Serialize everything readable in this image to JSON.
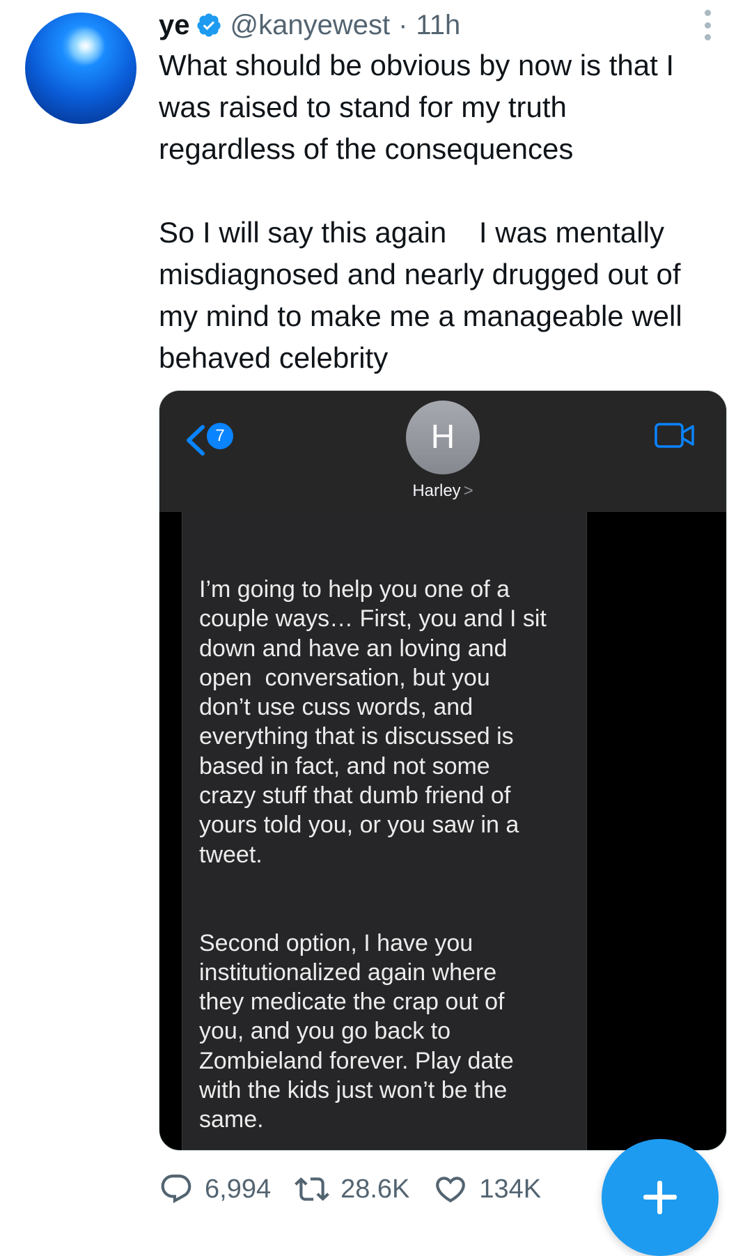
{
  "tweet": {
    "author": {
      "name": "ye",
      "handle": "@kanyewest",
      "separator": "·",
      "time": "11h",
      "avatar_icon": "blue-globe-avatar",
      "verified_icon": "verified-badge-icon"
    },
    "text": "What should be obvious by now is that I\nwas raised to stand for my truth\nregardless of the consequences\n\nSo I will say this again    I was mentally\nmisdiagnosed and nearly drugged out of\nmy mind to make me a manageable well\nbehaved celebrity",
    "media": {
      "back_badge_count": "7",
      "contact_initial": "H",
      "contact_name": "Harley",
      "contact_chevron": ">",
      "message": "I’m going to help you one of a\ncouple ways… First, you and I sit\ndown and have an loving and\nopen  conversation, but you\ndon’t use cuss words, and\neverything that is discussed is\nbased in fact, and not some\ncrazy stuff that dumb friend of\nyours told you, or you saw in a\ntweet.\n\n\nSecond option, I have you\ninstitutionalized again where\nthey medicate the crap out of\nyou, and you go back to\nZombieland forever. Play date\nwith the kids just won’t be the\nsame."
    },
    "actions": {
      "replies": "6,994",
      "retweets": "28.6K",
      "likes": "134K"
    }
  },
  "colors": {
    "accent": "#1d9bf0",
    "text_primary": "#0f1419",
    "text_secondary": "#536471",
    "imessage_blue": "#0a84ff"
  }
}
